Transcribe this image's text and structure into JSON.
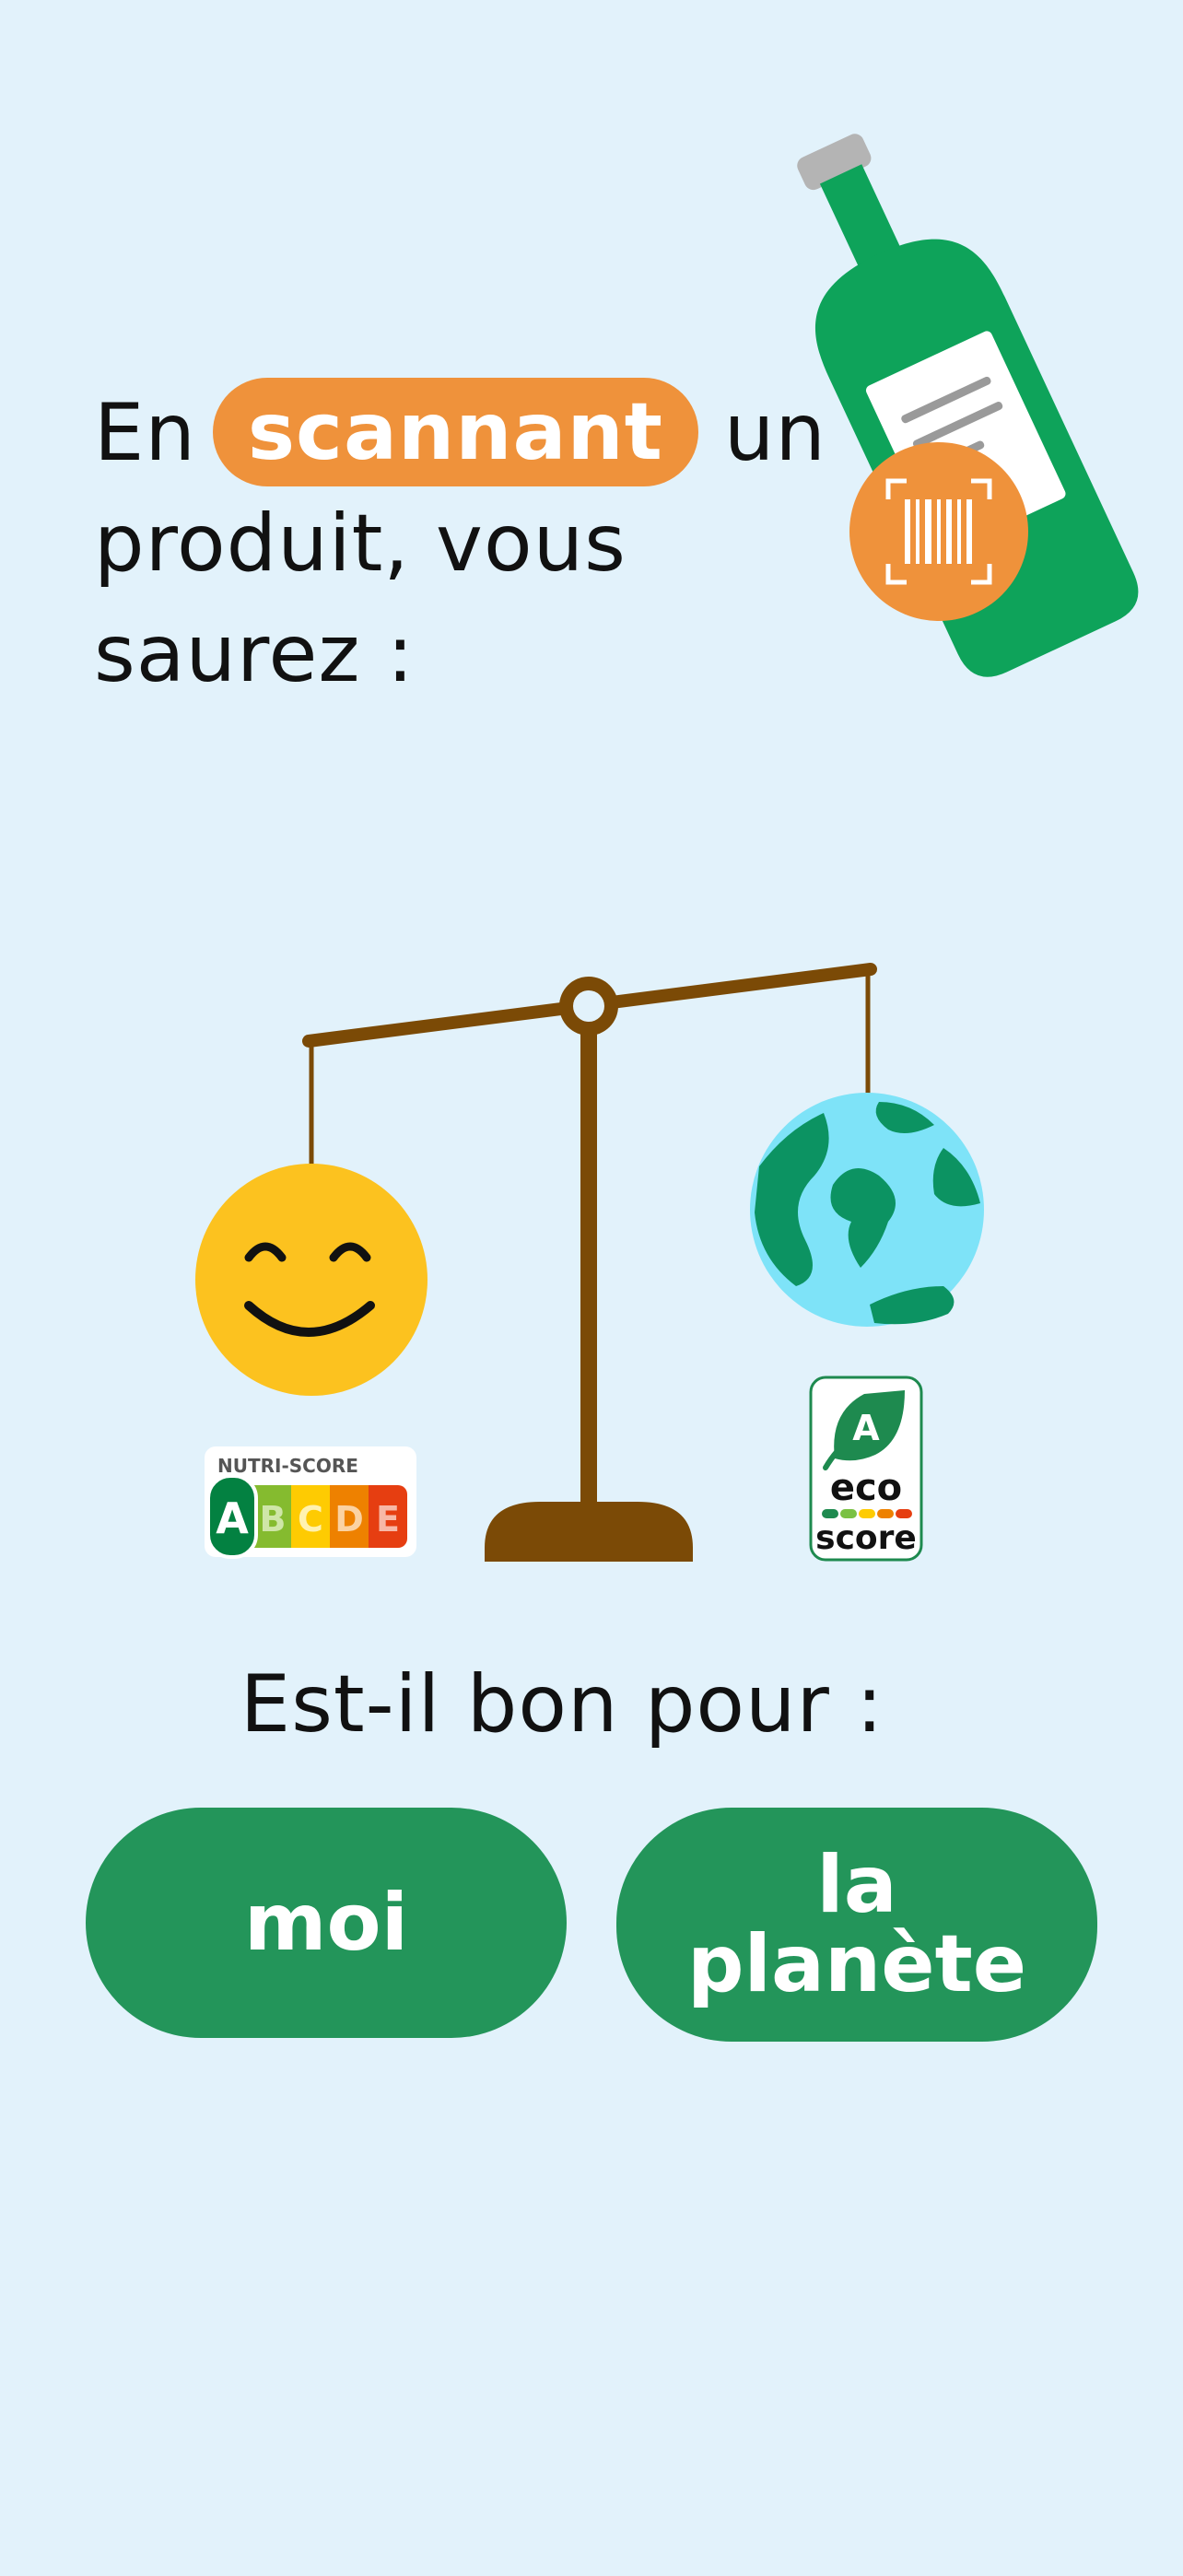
{
  "headline": {
    "word_before": "En",
    "highlight": "scannant",
    "word_after": "un",
    "line2": "produit, vous",
    "line3": "saurez :"
  },
  "question": "Est-il bon pour :",
  "buttons": {
    "me": "moi",
    "planet": "la\nplanète"
  },
  "badges": {
    "nutri_title": "NUTRI-SCORE",
    "nutri_grades": [
      "A",
      "B",
      "C",
      "D",
      "E"
    ],
    "eco_grade": "A",
    "eco_word1": "eco",
    "eco_word2": "score"
  },
  "icons": {
    "bottle": "bottle-icon",
    "barcode": "barcode-scan-icon",
    "scale": "balance-scale-icon",
    "smiley": "smiley-face-icon",
    "earth": "earth-globe-icon"
  },
  "colors": {
    "background": "#e2f2fb",
    "highlight": "#ef923b",
    "button": "#23955a",
    "bottle": "#0ea35a",
    "scale": "#7b4a06",
    "smiley": "#fcc21f",
    "ocean": "#7ee3f8",
    "land": "#0c9362"
  }
}
